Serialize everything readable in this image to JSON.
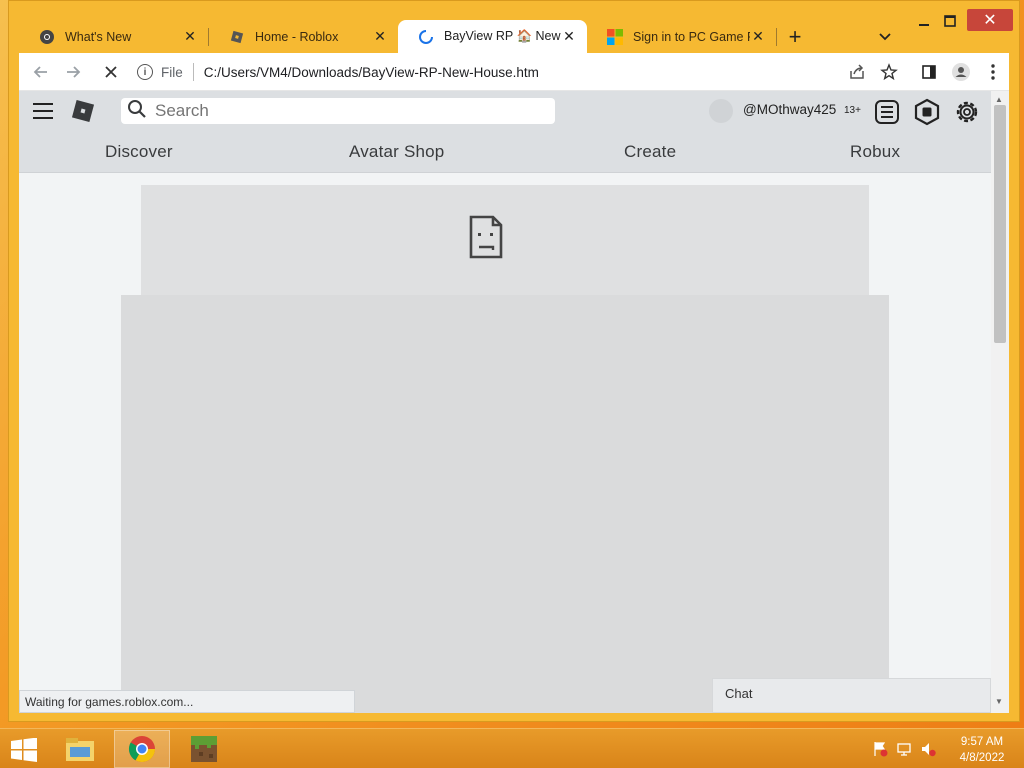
{
  "browser": {
    "tabs": [
      {
        "label": "What's New",
        "icon": "chrome-icon",
        "active": false
      },
      {
        "label": "Home - Roblox",
        "icon": "roblox-icon",
        "active": false
      },
      {
        "label": "BayView RP 🏠 New Ho",
        "icon": "loading-spinner-icon",
        "active": true
      },
      {
        "label": "Sign in to PC Game Pas",
        "icon": "microsoft-icon",
        "active": false
      }
    ],
    "new_tab": "+",
    "close": "✕",
    "scheme_label": "File",
    "url": "C:/Users/VM4/Downloads/BayView-RP-New-House.htm",
    "status": "Waiting for games.roblox.com..."
  },
  "roblox": {
    "search_placeholder": "Search",
    "username": "@MOthway425",
    "age_badge": "13+",
    "nav": [
      "Discover",
      "Avatar Shop",
      "Create",
      "Robux"
    ],
    "chat_label": "Chat"
  },
  "taskbar": {
    "time": "9:57 AM",
    "date": "4/8/2022"
  },
  "colors": {
    "accent": "#f6b932",
    "roblox_header": "#dcdfe2",
    "close_button": "#c7463a"
  }
}
